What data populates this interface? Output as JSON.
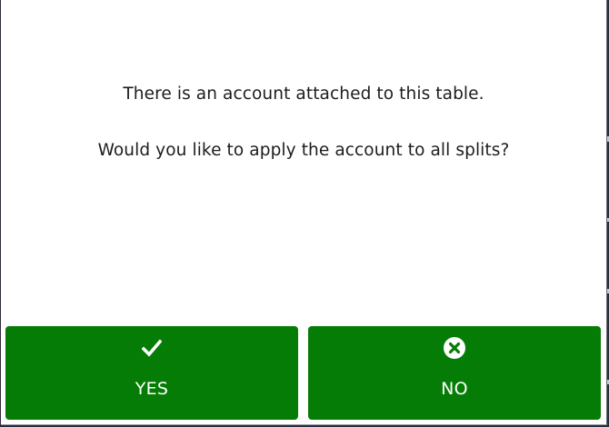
{
  "dialog": {
    "message_line1": "There is an account attached to this table.",
    "message_line2": "Would you like to apply the account to all splits?"
  },
  "buttons": {
    "yes": {
      "label": "YES",
      "icon": "checkmark-icon"
    },
    "no": {
      "label": "NO",
      "icon": "x-circle-icon"
    }
  },
  "colors": {
    "button_green": "#057c05",
    "text": "#1d1d1d",
    "background": "#ffffff"
  }
}
